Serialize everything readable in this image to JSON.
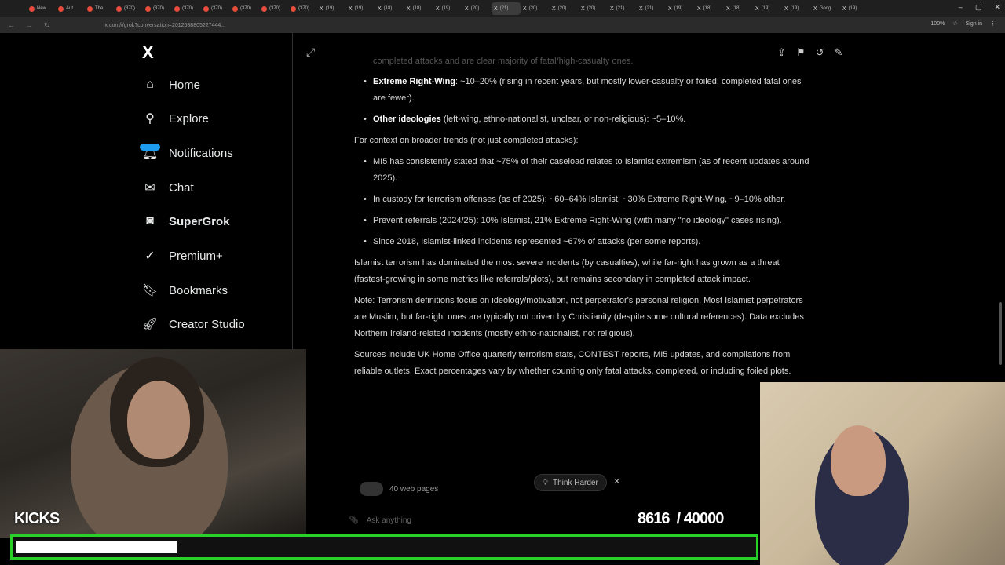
{
  "browser": {
    "tabs": [
      "New",
      "Aut",
      "The",
      "(370)",
      "(370)",
      "(370)",
      "(370)",
      "(370)",
      "(370)",
      "(370)",
      "(19)",
      "(19)",
      "(18)",
      "(18)",
      "(19)",
      "(20)",
      "(21)",
      "(20)",
      "(20)",
      "(20)",
      "(21)",
      "(21)",
      "(19)",
      "(18)",
      "(18)",
      "(19)",
      "(19)",
      "Goog",
      "(19)"
    ],
    "active_tab_index": 16,
    "url": "x.com/i/grok?conversation=2012638805227444...",
    "zoom": "100%",
    "sign_in": "Sign in"
  },
  "sidebar": {
    "logo": "X",
    "items": [
      {
        "label": "Home",
        "icon": "home-icon"
      },
      {
        "label": "Explore",
        "icon": "search-icon"
      },
      {
        "label": "Notifications",
        "icon": "bell-icon"
      },
      {
        "label": "Chat",
        "icon": "mail-icon"
      },
      {
        "label": "SuperGrok",
        "icon": "grok-icon"
      },
      {
        "label": "Premium+",
        "icon": "check-badge-icon"
      },
      {
        "label": "Bookmarks",
        "icon": "bookmark-icon"
      },
      {
        "label": "Creator Studio",
        "icon": "rocket-icon"
      }
    ]
  },
  "content": {
    "faded_line": "completed attacks and are clear majority of fatal/high-casualty ones.",
    "bullets_top": [
      {
        "bold": "Extreme Right-Wing",
        "text": ": ~10–20% (rising in recent years, but mostly lower-casualty or foiled; completed fatal ones are fewer)."
      },
      {
        "bold": "Other ideologies",
        "text": " (left-wing, ethno-nationalist, unclear, or non-religious): ~5–10%."
      }
    ],
    "context_intro": "For context on broader trends (not just completed attacks):",
    "bullets_context": [
      "MI5 has consistently stated that ~75% of their caseload relates to Islamist extremism (as of recent updates around 2025).",
      "In custody for terrorism offenses (as of 2025): ~60–64% Islamist, ~30% Extreme Right-Wing, ~9–10% other.",
      "Prevent referrals (2024/25): 10% Islamist, 21% Extreme Right-Wing (with many \"no ideology\" cases rising).",
      "Since 2018, Islamist-linked incidents represented ~67% of attacks (per some reports)."
    ],
    "summary": "Islamist terrorism has dominated the most severe incidents (by casualties), while far-right has grown as a threat (fastest-growing in some metrics like referrals/plots), but remains secondary in completed attack impact.",
    "note": "Note: Terrorism definitions focus on ideology/motivation, not perpetrator's personal religion. Most Islamist perpetrators are Muslim, but far-right ones are typically not driven by Christianity (despite some cultural references). Data excludes Northern Ireland-related incidents (mostly ethno-nationalist, not religious).",
    "sources": "Sources include UK Home Office quarterly terrorism stats, CONTEST reports, MI5 updates, and compilations from reliable outlets. Exact percentages vary by whether counting only fatal attacks, completed, or including foiled plots.",
    "web_pages": "40 web pages",
    "think_harder": "Think Harder",
    "ask_placeholder": "Ask anything"
  },
  "overlay": {
    "kicks_label": "KICKS",
    "kicks_count": "8616",
    "kicks_goal": "/ 40000",
    "kicks_progress": 0.215,
    "bar_color": "#29d02a"
  }
}
